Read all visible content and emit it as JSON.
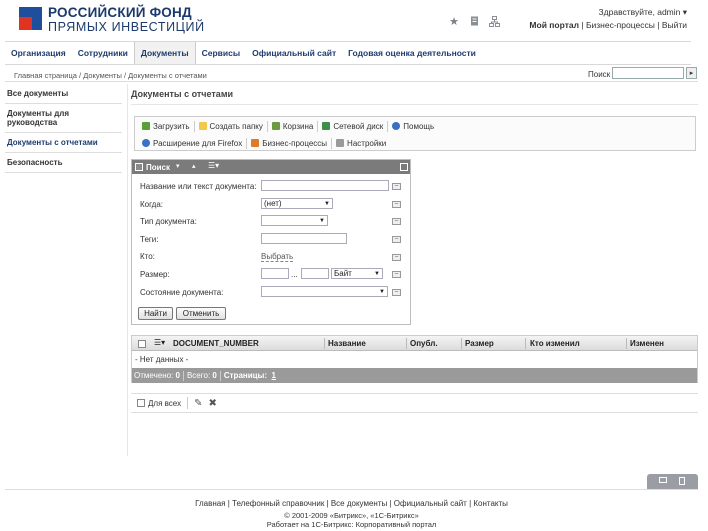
{
  "logo": {
    "line1": "РОССИЙСКИЙ ФОНД",
    "line2": "ПРЯМЫХ ИНВЕСТИЦИЙ",
    "brand_blue": "#1f4e9c",
    "brand_red": "#e03321"
  },
  "header": {
    "icons": [
      "star-icon",
      "document-icon",
      "network-icon"
    ],
    "user": "Здравствуйте, admin ▾",
    "my_portal": "Мой портал",
    "sep": "|",
    "bp": "Бизнес-процессы",
    "logout": "Выйти"
  },
  "topnav": {
    "items": [
      "Организация",
      "Сотрудники",
      "Документы",
      "Сервисы",
      "Официальный сайт",
      "Годовая оценка деятельности"
    ],
    "active": "Документы"
  },
  "breadcrumb": {
    "text": "Главная страница / Документы / Документы с отчетами"
  },
  "search": {
    "label": "Поиск",
    "value": "",
    "go": "▸"
  },
  "sidebar": {
    "items": [
      "Все документы",
      "Документы для руководства",
      "Документы с отчетами",
      "Безопасность"
    ],
    "active": "Документы с отчетами"
  },
  "page": {
    "title": "Документы с отчетами"
  },
  "toolbar": {
    "upload": "Загрузить",
    "create_folder": "Создать папку",
    "trash": "Корзина",
    "network_disk": "Сетевой диск",
    "help": "Помощь",
    "firefox_ext": "Расширение для Firefox",
    "bizproc": "Бизнес-процессы",
    "settings": "Настройки"
  },
  "filter": {
    "header": "Поиск",
    "name_label": "Название или текст документа:",
    "name_value": "",
    "when_label": "Когда:",
    "when_value": "(нет)",
    "type_label": "Тип документа:",
    "type_value": "",
    "tags_label": "Теги:",
    "tags_value": "",
    "who_label": "Кто:",
    "who_link": "Выбрать",
    "size_label": "Размер:",
    "size_from": "",
    "size_dots": "...",
    "size_to": "",
    "size_unit": "Байт",
    "state_label": "Состояние документа:",
    "state_value": "",
    "find": "Найти",
    "cancel": "Отменить"
  },
  "grid": {
    "columns": [
      "DOCUMENT_NUMBER",
      "Название",
      "Опубл.",
      "Размер",
      "Кто изменил",
      "Изменен"
    ],
    "empty": "- Нет данных -",
    "footer": {
      "marked_label": "Отмечено:",
      "marked": "0",
      "total_label": "Всего:",
      "total": "0",
      "pages_label": "Страницы:",
      "page": "1"
    }
  },
  "actions": {
    "for_all": "Для всех",
    "edit_icon": "pencil-icon",
    "delete_icon": "cross-icon"
  },
  "footer": {
    "links": [
      "Главная",
      "Телефонный справочник",
      "Все документы",
      "Официальный сайт",
      "Контакты"
    ],
    "copyright": "© 2001-2009 «Битрикс», «1С-Битрикс»",
    "powered": "Работает на 1С-Битрикс: Корпоративный портал"
  }
}
